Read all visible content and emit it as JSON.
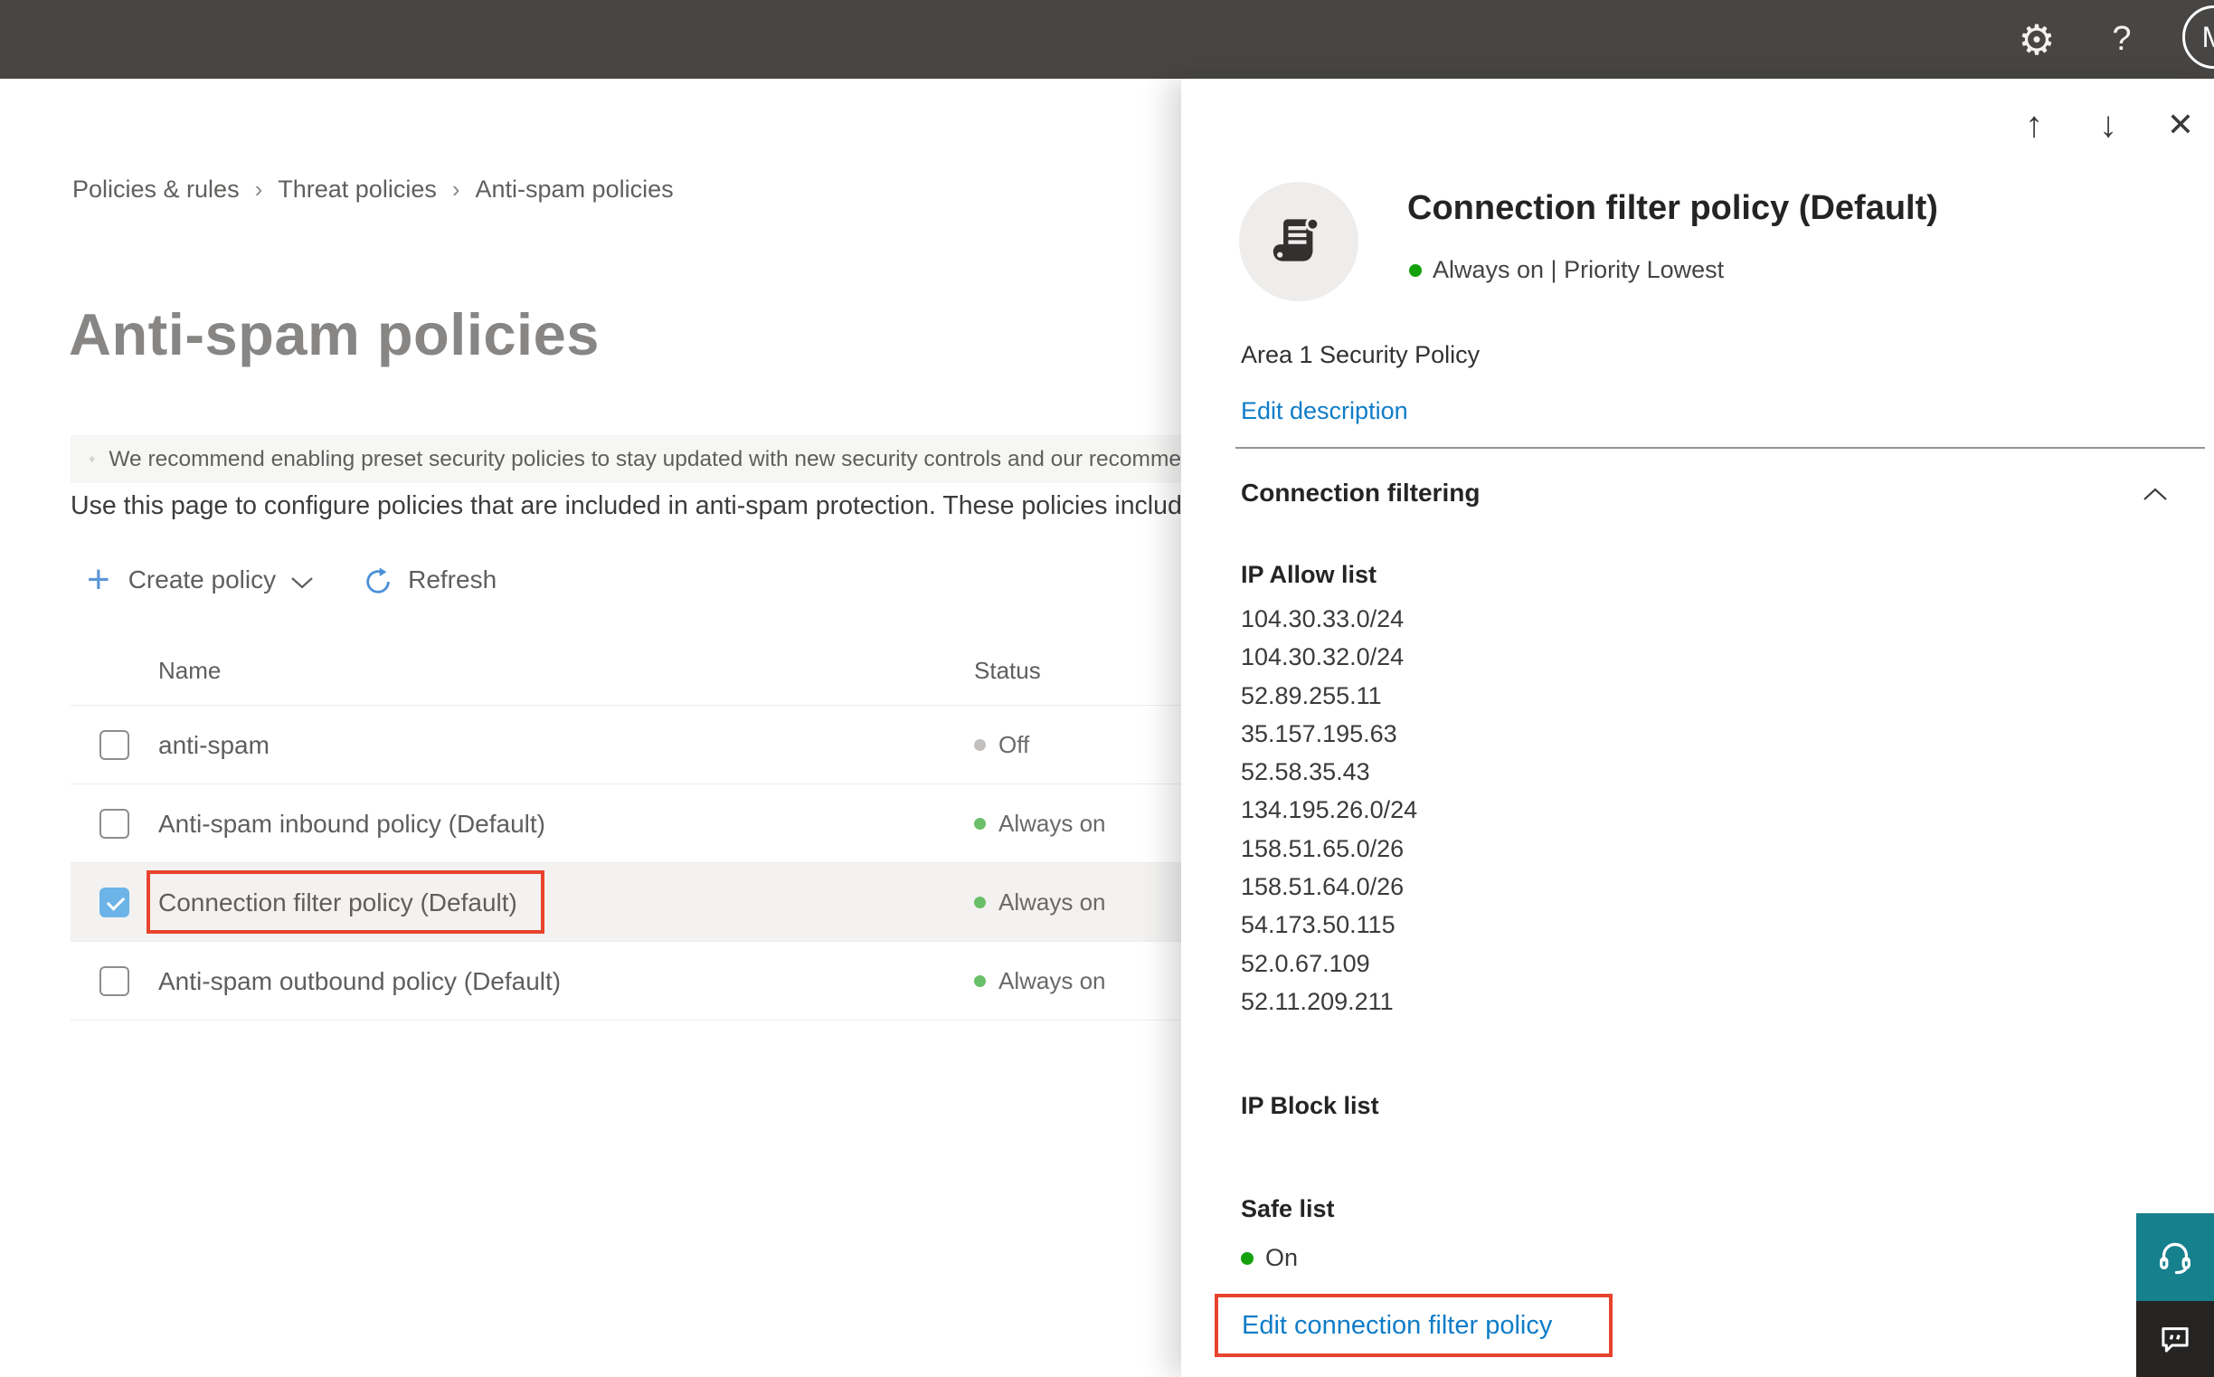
{
  "topbar": {
    "gear_icon": "⚙",
    "help_icon": "?",
    "avatar_initial": "M"
  },
  "breadcrumb": {
    "separator": "›",
    "items": [
      {
        "label": "Policies & rules"
      },
      {
        "label": "Threat policies"
      },
      {
        "label": "Anti-spam policies"
      }
    ]
  },
  "page": {
    "title": "Anti-spam policies",
    "banner": {
      "text": "We recommend enabling preset security policies to stay updated with new security controls and our recomme"
    },
    "intro": "Use this page to configure policies that are included in anti-spam protection. These policies include",
    "toolbar": {
      "create_icon": "+",
      "create_label": "Create policy",
      "refresh_label": "Refresh"
    },
    "table": {
      "columns": {
        "name": "Name",
        "status": "Status"
      },
      "rows": [
        {
          "name": "anti-spam",
          "status": "Off",
          "status_kind": "off",
          "checked": false,
          "selected": false,
          "highlighted": false
        },
        {
          "name": "Anti-spam inbound policy (Default)",
          "status": "Always on",
          "status_kind": "on",
          "checked": false,
          "selected": false,
          "highlighted": false
        },
        {
          "name": "Connection filter policy (Default)",
          "status": "Always on",
          "status_kind": "on",
          "checked": true,
          "selected": true,
          "highlighted": true
        },
        {
          "name": "Anti-spam outbound policy (Default)",
          "status": "Always on",
          "status_kind": "on",
          "checked": false,
          "selected": false,
          "highlighted": false
        }
      ]
    }
  },
  "flyout": {
    "nav": {
      "up_icon": "↑",
      "down_icon": "↓",
      "close_icon": "✕"
    },
    "title": "Connection filter policy (Default)",
    "status_text": "Always on | Priority Lowest",
    "description": "Area 1 Security Policy",
    "edit_description_label": "Edit description",
    "section": {
      "title": "Connection filtering"
    },
    "ip_allow": {
      "label": "IP Allow list",
      "items": [
        "104.30.33.0/24",
        "104.30.32.0/24",
        "52.89.255.11",
        "35.157.195.63",
        "52.58.35.43",
        "134.195.26.0/24",
        "158.51.65.0/26",
        "158.51.64.0/26",
        "54.173.50.115",
        "52.0.67.109",
        "52.11.209.211"
      ]
    },
    "ip_block": {
      "label": "IP Block list"
    },
    "safe_list": {
      "label": "Safe list",
      "status": "On"
    },
    "edit_policy_label": "Edit connection filter policy"
  },
  "colors": {
    "topbar_bg": "#484644",
    "accent_blue_link": "#0f7cc8",
    "toolbar_icon_blue": "#4a90d9",
    "selection_red": "#e8432d",
    "checkbox_checked_blue": "#6cb4e8",
    "status_green_table": "#6abf69",
    "status_green_bright": "#13a10e",
    "status_gray": "#c3c1bf",
    "support_teal": "#17808d",
    "feedback_dark": "#252423"
  }
}
